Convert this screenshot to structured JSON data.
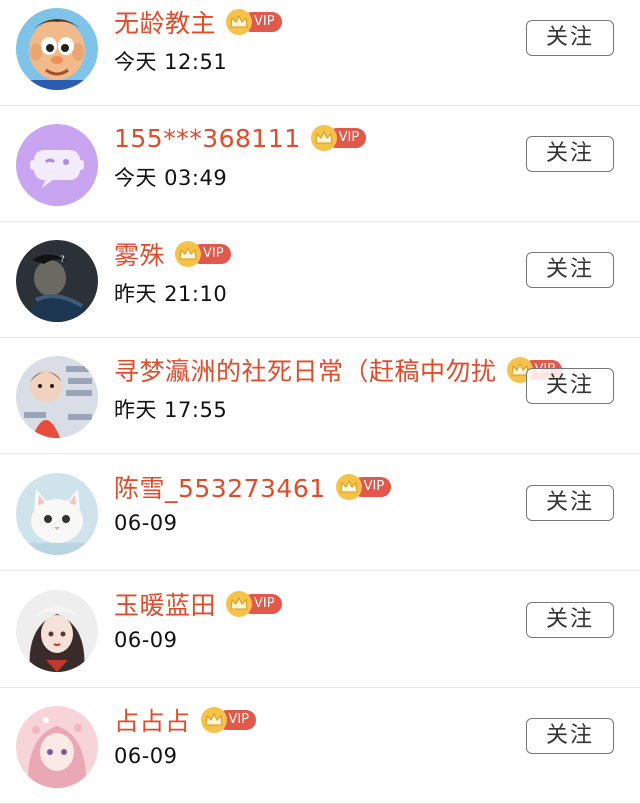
{
  "follow_label": "关注",
  "vip_label": "VIP",
  "colors": {
    "name": "#e14b2a",
    "vip_badge": "#e2584a",
    "crown": "#f6c24a"
  },
  "users": [
    {
      "name": "无龄教主",
      "time": "今天 12:51",
      "avatar": "cartoon-boy-avatar"
    },
    {
      "name": "155***368111",
      "time": "今天 03:49",
      "avatar": "default-chat-avatar"
    },
    {
      "name": "雾殊",
      "time": "昨天 21:10",
      "avatar": "painting-avatar"
    },
    {
      "name": "寻梦瀛洲的社死日常（赶稿中勿扰",
      "time": "昨天 17:55",
      "avatar": "child-sticker-avatar"
    },
    {
      "name": "陈雪_553273461",
      "time": "06-09",
      "avatar": "white-cat-avatar"
    },
    {
      "name": "玉暖蓝田",
      "time": "06-09",
      "avatar": "anime-girl-avatar"
    },
    {
      "name": "占占占",
      "time": "06-09",
      "avatar": "pink-girl-avatar"
    }
  ]
}
